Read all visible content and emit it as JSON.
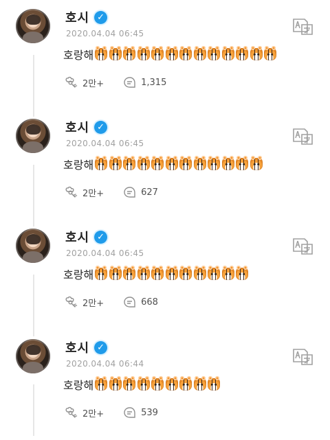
{
  "posts": [
    {
      "author": "호시",
      "timestamp": "2020.04.04 06:45",
      "text": "호랑해",
      "tiger_count": 13,
      "likes": "2만+",
      "comments": "1,315"
    },
    {
      "author": "호시",
      "timestamp": "2020.04.04 06:45",
      "text": "호랑해",
      "tiger_count": 12,
      "likes": "2만+",
      "comments": "627"
    },
    {
      "author": "호시",
      "timestamp": "2020.04.04 06:45",
      "text": "호랑해",
      "tiger_count": 11,
      "likes": "2만+",
      "comments": "668"
    },
    {
      "author": "호시",
      "timestamp": "2020.04.04 06:44",
      "text": "호랑해",
      "tiger_count": 9,
      "likes": "2만+",
      "comments": "539"
    }
  ],
  "colors": {
    "verified": "#1f9bea",
    "timestamp": "#a1a1a1",
    "text": "#252525",
    "thread_line": "#e6e6e6"
  },
  "icons": {
    "verified": "verified-check-icon",
    "translate": "translate-icon",
    "like": "like-icon",
    "comment": "comment-icon",
    "emoji": "tiger-emoji-icon"
  }
}
